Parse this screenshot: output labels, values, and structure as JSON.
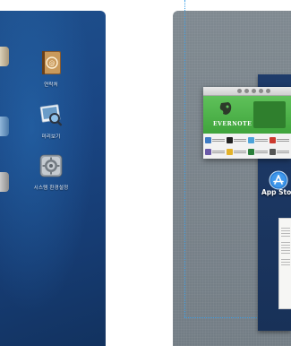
{
  "launchpad": {
    "apps": [
      {
        "label": "연락처",
        "icon": "address-book-icon"
      },
      {
        "label": "미리보기",
        "icon": "preview-icon"
      },
      {
        "label": "시스템 환경설정",
        "icon": "system-preferences-icon"
      }
    ]
  },
  "mission_control": {
    "featured_app_banner": "EVERNOTE",
    "active_app_label": "App Sto",
    "active_app_icon": "app-store-icon"
  },
  "colors": {
    "launchpad_bg": "#1a4684",
    "mission_bg": "#7a848b",
    "evernote_green": "#4fb34b",
    "selection_dotted": "#3aa0e8"
  }
}
